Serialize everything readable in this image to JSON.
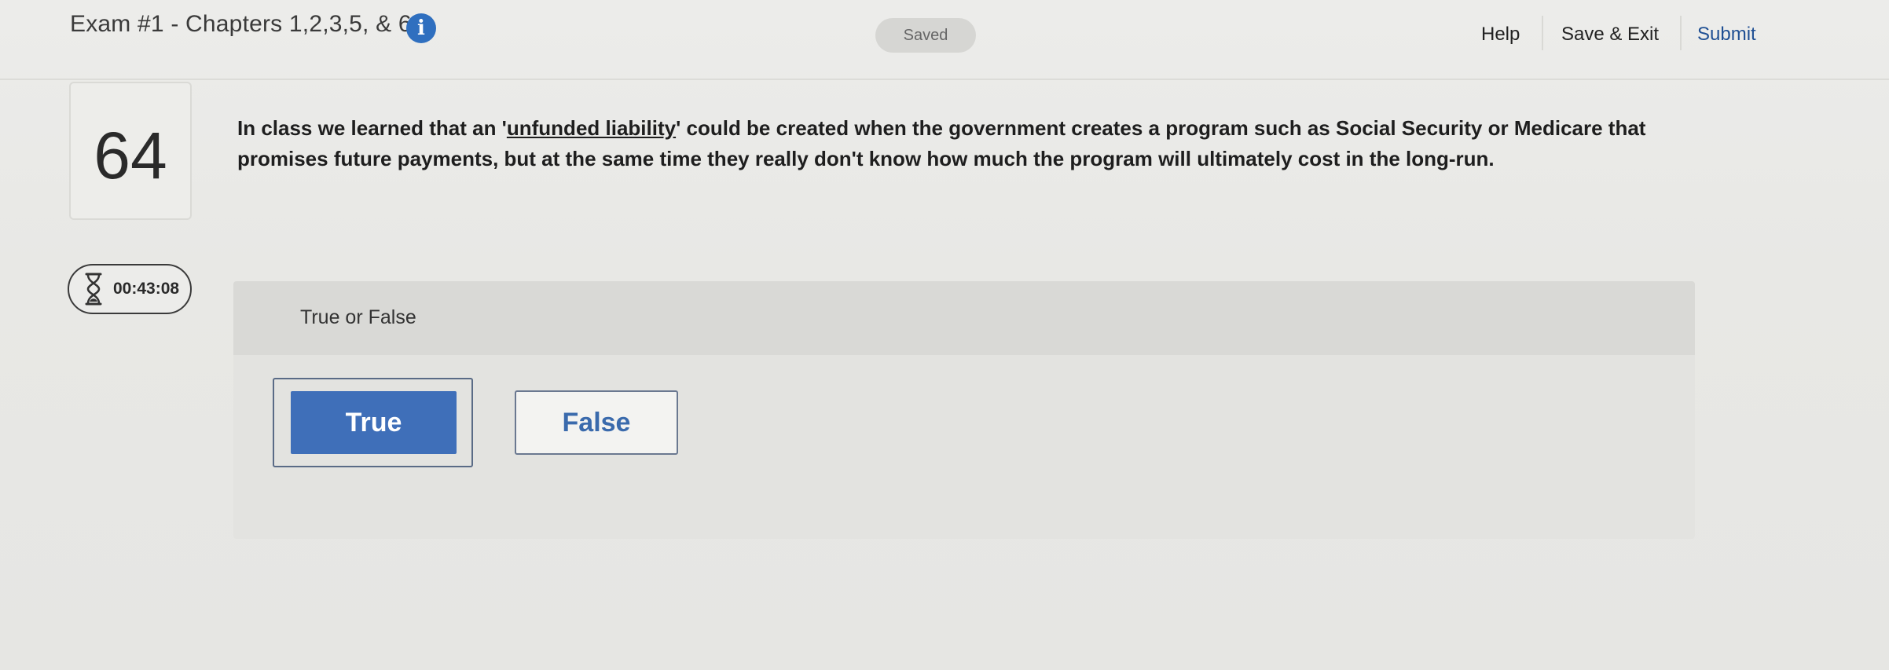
{
  "header": {
    "exam_title": "Exam #1 - Chapters 1,2,3,5, & 6",
    "info_icon": "info-icon",
    "save_status": "Saved",
    "nav": {
      "help": "Help",
      "save_exit": "Save & Exit",
      "submit": "Submit"
    }
  },
  "question": {
    "number": "64",
    "text_before": "In class we learned that an '",
    "text_underlined": "unfunded liability",
    "text_after": "' could be created when the government creates a program such as Social Security or Medicare that promises future payments, but at the same time they really don't know how much the program will ultimately cost in the long-run."
  },
  "timer": {
    "icon": "hourglass-icon",
    "time": "00:43:08"
  },
  "answer": {
    "type_label": "True or False",
    "options": [
      {
        "label": "True",
        "selected": true
      },
      {
        "label": "False",
        "selected": false
      }
    ]
  },
  "colors": {
    "accent": "#3f6fb9",
    "info_icon": "#2f6fbf",
    "submit_link": "#1f4f93"
  }
}
